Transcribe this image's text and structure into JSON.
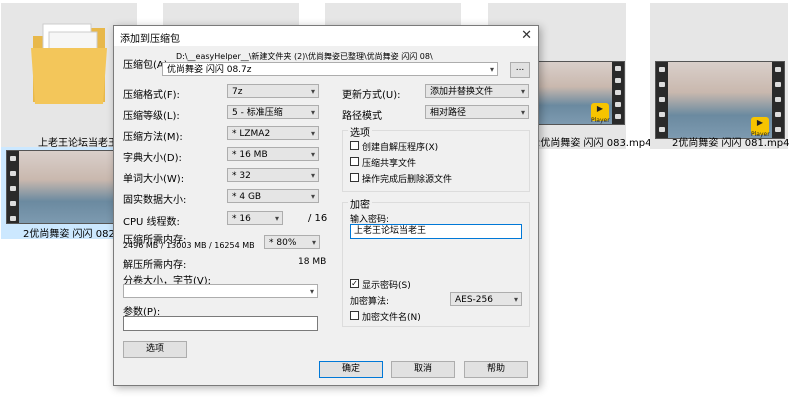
{
  "explorer": {
    "tiles": [
      {
        "caption": "上老王论坛当老王"
      },
      {
        "caption": ""
      },
      {
        "caption": ""
      },
      {
        "caption": "2优尚舞姿 闪闪 083.mp4",
        "badge": "Player"
      },
      {
        "caption": "2优尚舞姿 闪闪 081.mp4",
        "badge": "Player"
      },
      {
        "caption": "2优尚舞姿 闪闪 082.mp"
      }
    ]
  },
  "dialog": {
    "title": "添加到压缩包",
    "archive_label": "压缩包(A):",
    "archive_path": "D:\\__easyHelper__\\新建文件夹 (2)\\优尚舞姿已整理\\优尚舞姿 闪闪 08\\",
    "archive_name": "优尚舞姿 闪闪 08.7z",
    "browse_label": "...",
    "left": {
      "format_label": "压缩格式(F):",
      "format_value": "7z",
      "level_label": "压缩等级(L):",
      "level_value": "5 - 标准压缩",
      "method_label": "压缩方法(M):",
      "method_value": "* LZMA2",
      "dict_label": "字典大小(D):",
      "dict_value": "* 16 MB",
      "word_label": "单词大小(W):",
      "word_value": "* 32",
      "solid_label": "固实数据大小:",
      "solid_value": "* 4 GB",
      "threads_label": "CPU 线程数:",
      "threads_value": "* 16",
      "threads_total": "/ 16",
      "mem_comp_label": "压缩所需内存:",
      "mem_comp_values": "2496 MB / 13003 MB / 16254 MB",
      "mem_percent": "* 80%",
      "mem_decomp_label": "解压所需内存:",
      "mem_decomp_value": "18 MB",
      "split_label": "分卷大小，字节(V):",
      "split_value": "",
      "params_label": "参数(P):",
      "params_value": "",
      "options_button": "选项"
    },
    "right": {
      "update_label": "更新方式(U):",
      "update_value": "添加并替换文件",
      "path_label": "路径模式",
      "path_value": "相对路径",
      "options_group": "选项",
      "opt_sfx": "创建自解压程序(X)",
      "opt_shared": "压缩共享文件",
      "opt_delete": "操作完成后删除源文件",
      "encrypt_group": "加密",
      "password_label": "输入密码:",
      "password_value": "上老王论坛当老王",
      "show_password": "显示密码(S)",
      "encrypt_method_label": "加密算法:",
      "encrypt_method_value": "AES-256",
      "encrypt_names": "加密文件名(N)"
    },
    "buttons": {
      "ok": "确定",
      "cancel": "取消",
      "help": "帮助"
    }
  }
}
